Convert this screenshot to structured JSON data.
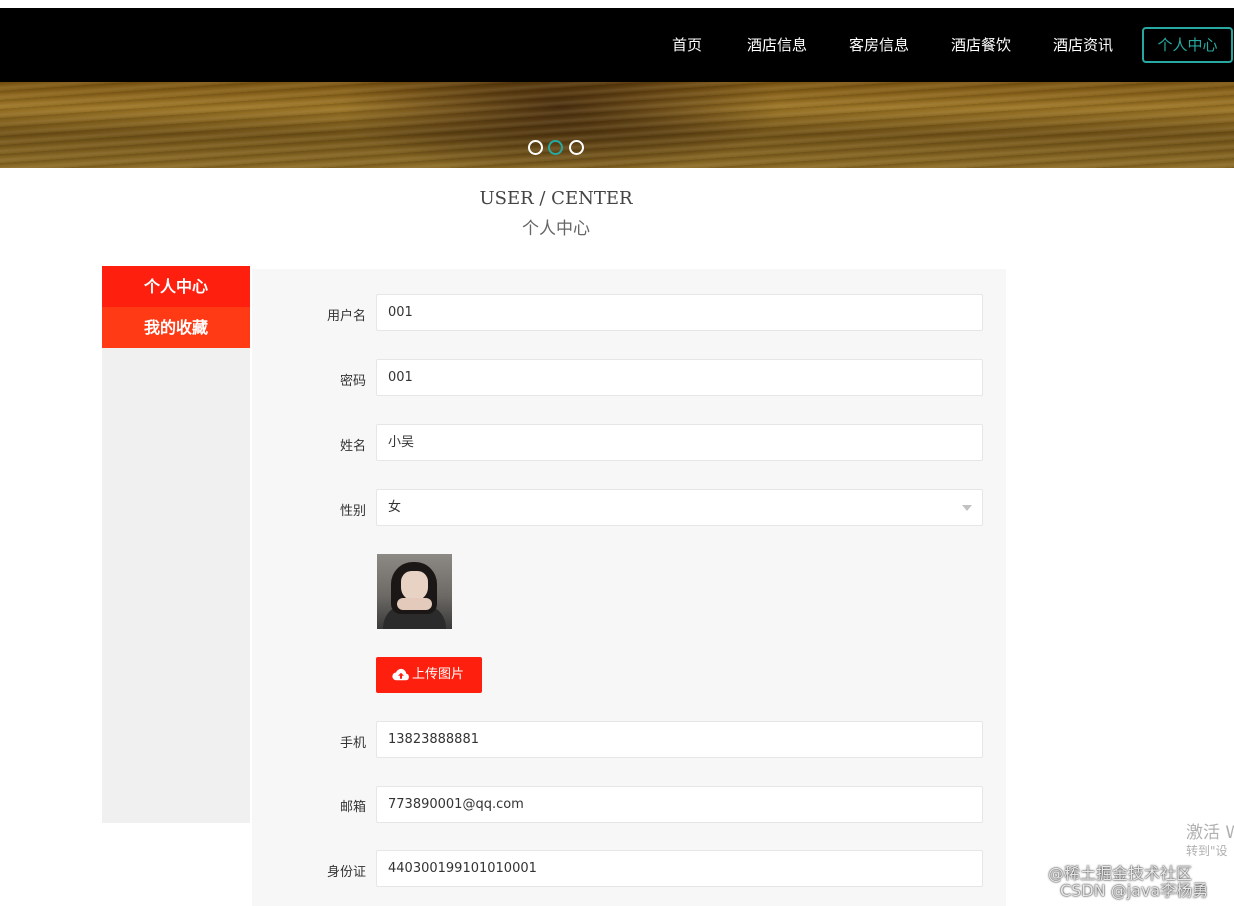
{
  "nav": {
    "items": [
      "首页",
      "酒店信息",
      "客房信息",
      "酒店餐饮",
      "酒店资讯"
    ],
    "active": "个人中心"
  },
  "banner": {
    "dots": 3,
    "active_dot": 1
  },
  "heading": {
    "en": "USER / CENTER",
    "cn": "个人中心"
  },
  "sidebar": {
    "items": [
      "个人中心",
      "我的收藏"
    ]
  },
  "form": {
    "username": {
      "label": "用户名",
      "value": "001"
    },
    "password": {
      "label": "密码",
      "value": "001"
    },
    "name": {
      "label": "姓名",
      "value": "小吴"
    },
    "gender": {
      "label": "性别",
      "value": "女"
    },
    "upload_label": "上传图片",
    "phone": {
      "label": "手机",
      "value": "13823888881"
    },
    "email": {
      "label": "邮箱",
      "value": "773890001@qq.com"
    },
    "id_card": {
      "label": "身份证",
      "value": "440300199101010001"
    }
  },
  "icons": {
    "upload": "cloud-upload-icon",
    "select": "chevron-down-icon"
  },
  "colors": {
    "accent": "#27a9a1",
    "primary": "#ff1f0f"
  },
  "watermarks": {
    "windows_line1": "激活 W",
    "windows_line2": "转到\"设",
    "site1": "@稀土掘金技术社区",
    "site2": "CSDN @java李杨勇"
  }
}
